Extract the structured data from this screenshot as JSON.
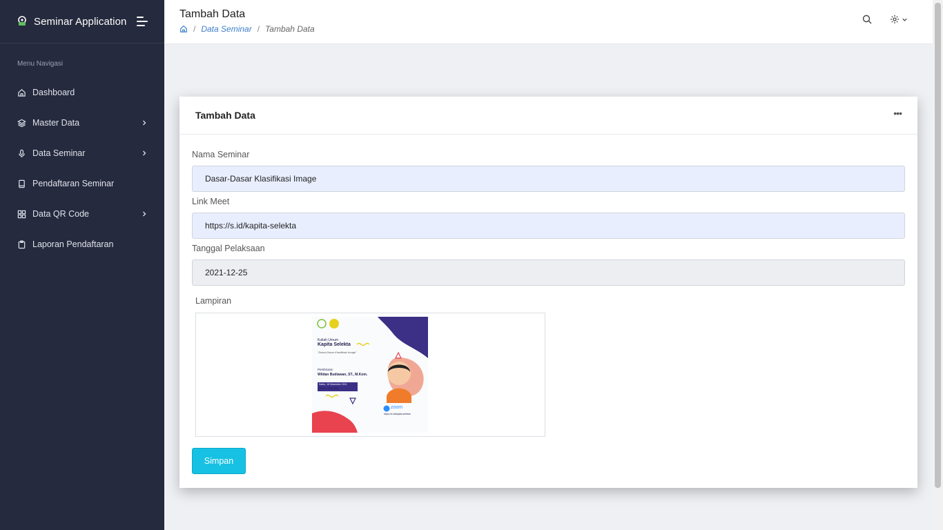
{
  "app": {
    "title": "Seminar Application"
  },
  "sidebar": {
    "menu_label": "Menu Navigasi",
    "items": [
      {
        "label": "Dashboard",
        "icon": "home-icon",
        "has_submenu": false
      },
      {
        "label": "Master Data",
        "icon": "layers-icon",
        "has_submenu": true
      },
      {
        "label": "Data Seminar",
        "icon": "microphone-icon",
        "has_submenu": true
      },
      {
        "label": "Pendaftaran Seminar",
        "icon": "book-icon",
        "has_submenu": false
      },
      {
        "label": "Data QR Code",
        "icon": "grid-icon",
        "has_submenu": true
      },
      {
        "label": "Laporan Pendaftaran",
        "icon": "clipboard-icon",
        "has_submenu": false
      }
    ]
  },
  "header": {
    "title": "Tambah Data",
    "breadcrumb": {
      "home_icon": "home-icon",
      "link": "Data Seminar",
      "current": "Tambah Data",
      "separator": "/"
    },
    "icons": [
      "search-icon",
      "gear-icon",
      "chevron-down-icon"
    ]
  },
  "card": {
    "title": "Tambah Data",
    "menu_icon": "more-horizontal-icon",
    "form": {
      "nama_seminar": {
        "label": "Nama Seminar",
        "value": "Dasar-Dasar Klasifikasi Image"
      },
      "link_meet": {
        "label": "Link Meet",
        "value": "https://s.id/kapita-selekta"
      },
      "tanggal": {
        "label": "Tanggal Pelaksaan",
        "value": "2021-12-25"
      },
      "lampiran": {
        "label": "Lampiran"
      }
    },
    "submit_label": "Simpan"
  },
  "poster": {
    "line1": "Kuliah Umum",
    "line2": "Kapita Selekta",
    "line3": "\"Dasar-Dasar Klasifikasi Image\"",
    "speaker_label": "Pembicara:",
    "speaker": "Wildan Budiawan, ST., M.Kom.",
    "date": "Sabtu, 18 Desember 2021",
    "time": "09.00 - 10.30 WIB",
    "platform": "zoom",
    "link": "https://s.id/kapita-selekta"
  },
  "colors": {
    "sidebar_bg": "#262a3e",
    "accent_button": "#16c1e3",
    "link": "#3d7ec9",
    "input_autofill_bg": "#e8eefe"
  }
}
